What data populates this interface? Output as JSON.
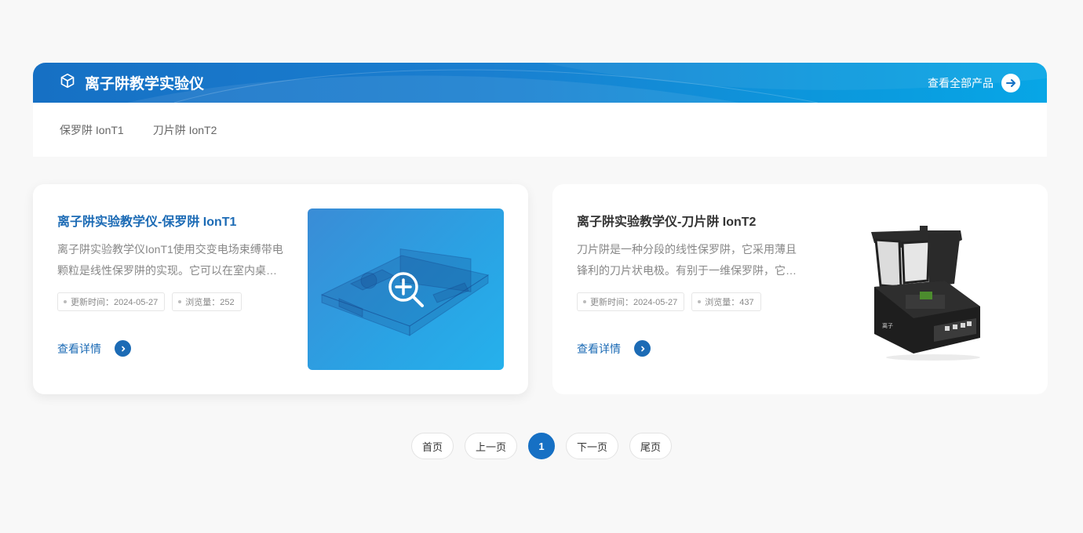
{
  "banner": {
    "title": "离子阱教学实验仪",
    "view_all": "查看全部产品"
  },
  "tabs": [
    {
      "label": "保罗阱 IonT1"
    },
    {
      "label": "刀片阱 IonT2"
    }
  ],
  "products": [
    {
      "title": "离子阱实验教学仪-保罗阱 IonT1",
      "desc_line1": "离子阱实验教学仪IonT1使用交变电场束缚带电",
      "desc_line2": "颗粒是线性保罗阱的实现。它可以在室内桌…",
      "updated": "更新时间：2024-05-27",
      "views": "浏览量：252",
      "more": "查看详情"
    },
    {
      "title": "离子阱实验教学仪-刀片阱 IonT2",
      "desc_line1": "刀片阱是一种分段的线性保罗阱，它采用薄且",
      "desc_line2": "锋利的刀片状电极。有别于一维保罗阱，它…",
      "updated": "更新时间：2024-05-27",
      "views": "浏览量：437",
      "more": "查看详情"
    }
  ],
  "pagination": {
    "first": "首页",
    "prev": "上一页",
    "current": "1",
    "next": "下一页",
    "last": "尾页"
  },
  "colors": {
    "accent": "#1670c4",
    "link": "#1c6bb5"
  }
}
